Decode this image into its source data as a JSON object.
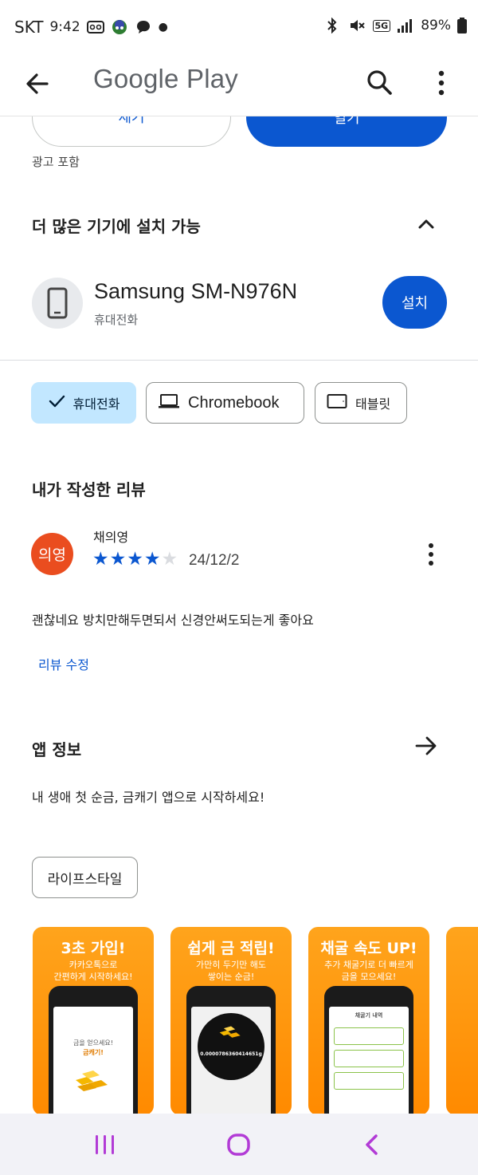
{
  "status_bar": {
    "carrier": "SKT",
    "time": "9:42",
    "battery": "89%",
    "network": "5G"
  },
  "app_bar": {
    "title": "Google Play",
    "back_icon": "arrow-left-icon",
    "search_icon": "search-icon",
    "more_icon": "more-vert-icon"
  },
  "top_actions": {
    "uninstall_label": "제거",
    "open_label": "열기"
  },
  "ad_notice": "광고 포함",
  "more_devices": {
    "title": "더 많은 기기에 설치 가능",
    "device_name": "Samsung SM-N976N",
    "device_type": "휴대전화",
    "install_label": "설치"
  },
  "device_chips": [
    {
      "label": "휴대전화",
      "selected": true,
      "icon": "check-icon"
    },
    {
      "label": "Chromebook",
      "selected": false,
      "icon": "laptop-icon"
    },
    {
      "label": "태블릿",
      "selected": false,
      "icon": "tablet-icon"
    }
  ],
  "my_review": {
    "title": "내가 작성한 리뷰",
    "avatar_text": "의영",
    "reviewer": "채의영",
    "rating": 4,
    "max_rating": 5,
    "date": "24/12/2",
    "text": "괜찮네요 방치만해두면되서 신경안써도되는게 좋아요",
    "edit_label": "리뷰 수정"
  },
  "app_info": {
    "title": "앱 정보",
    "description": "내 생애 첫 순금, 금캐기 앱으로 시작하세요!",
    "category": "라이프스타일"
  },
  "screenshots": [
    {
      "title": "3초 가입!",
      "subtitle": "카카오톡으로\n간편하게 시작하세요!",
      "screen_line1": "금을 얻으세요!",
      "screen_line2": "금캐기!"
    },
    {
      "title": "쉽게 금 적립!",
      "subtitle": "가만히 두기만 해도\n쌓이는 순금!",
      "screen_line1": "0.0000786360414651g",
      "screen_line2": ""
    },
    {
      "title": "채굴 속도 UP!",
      "subtitle": "추가 채굴기로 더 빠르게\n금을 모으세요!",
      "screen_line1": "채굴기 내역",
      "screen_line2": ""
    }
  ],
  "colors": {
    "accent": "#0b57d0",
    "chip_selected": "#c2e7ff",
    "avatar": "#ea4d1f",
    "screenshot_bg": "#ff9a12",
    "nav_icons": "#b23bd6"
  }
}
